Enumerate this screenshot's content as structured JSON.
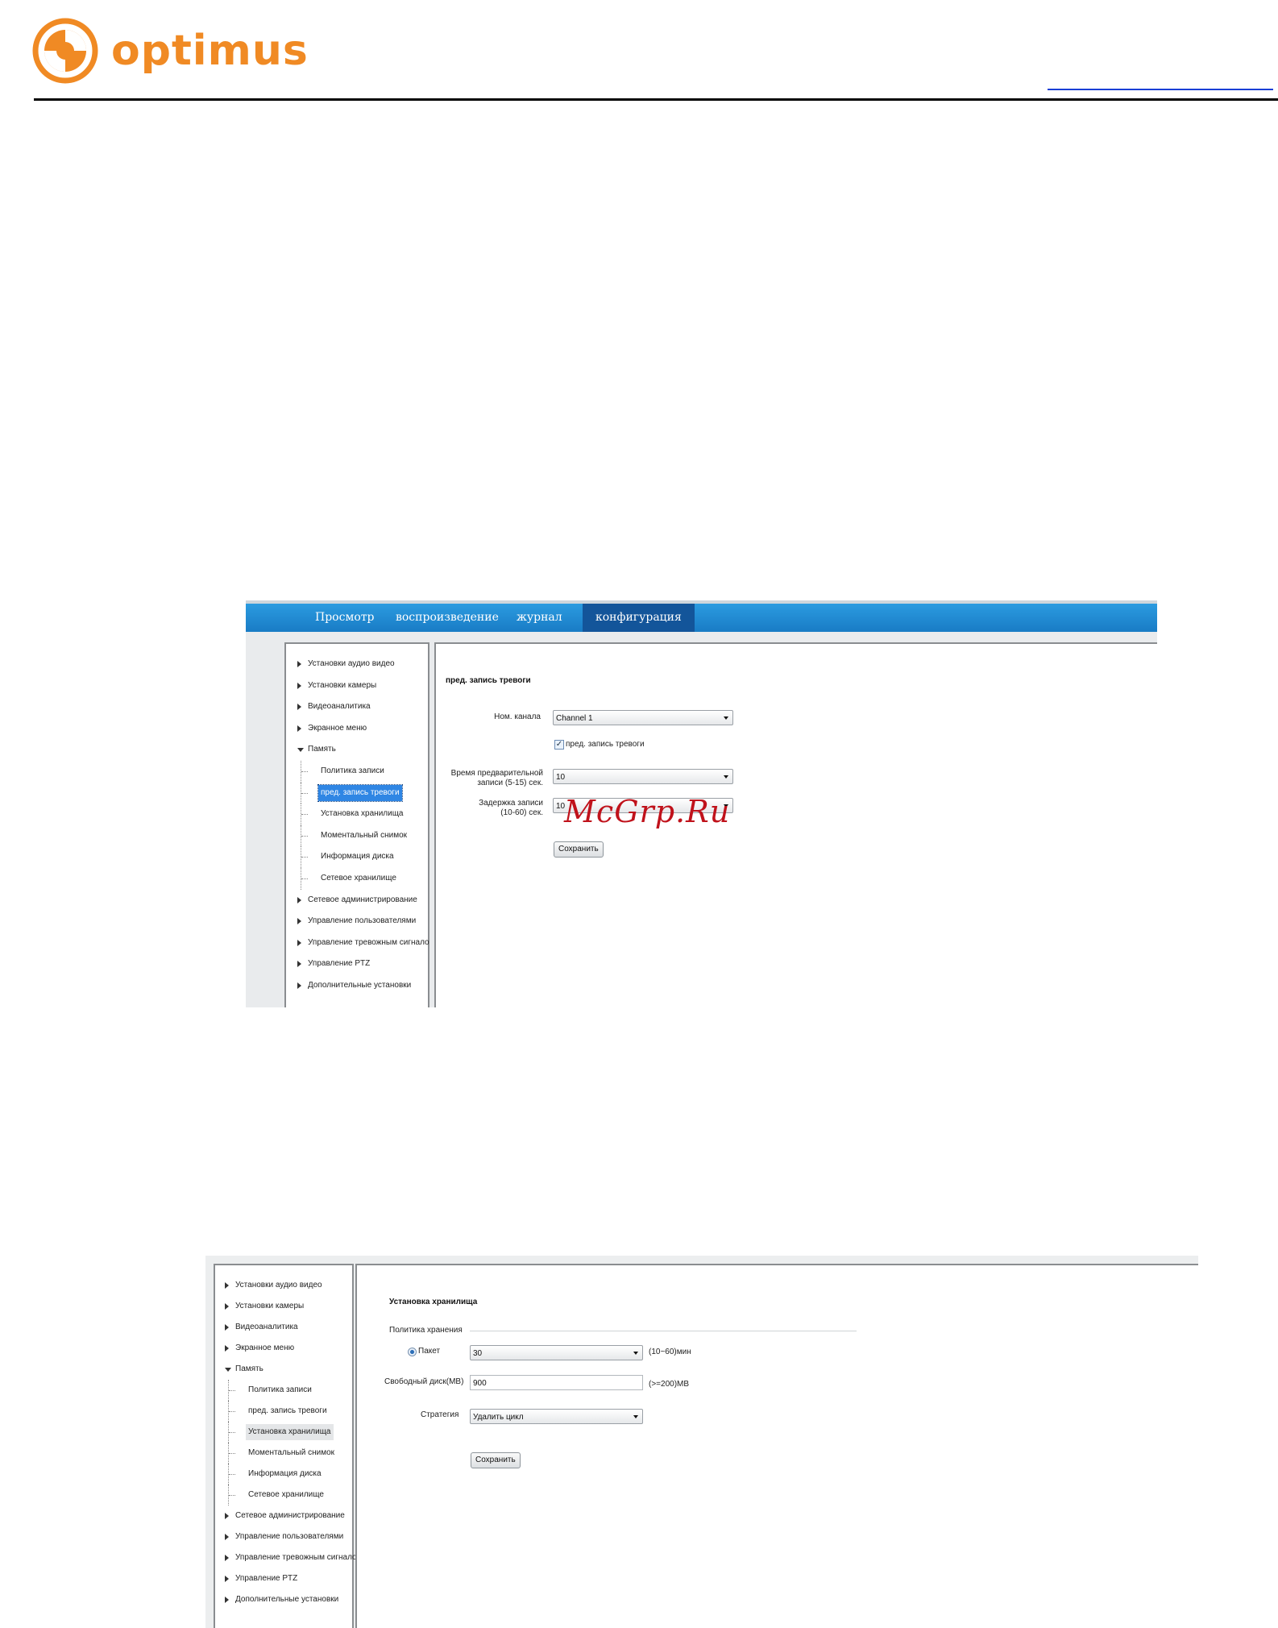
{
  "header": {
    "brand": "optimus",
    "colors": {
      "brand_orange": "#f08a24",
      "nav_blue": "#1778c2",
      "nav_active": "#13559a",
      "selected_item": "#2f86e4"
    }
  },
  "watermark": "McGrp.Ru",
  "shot1": {
    "nav_tabs": [
      "Просмотр",
      "воспроизведение",
      "журнал",
      "конфигурация"
    ],
    "active_tab": "конфигурация",
    "menu": [
      "Установки аудио видео",
      "Установки камеры",
      "Видеоаналитика",
      "Экранное меню",
      "Память",
      "Политика записи",
      "пред. запись тревоги",
      "Установка хранилища",
      "Моментальный снимок",
      "Информация диска",
      "Сетевое хранилище",
      "Сетевое администрирование",
      "Управление пользователями",
      "Управление тревожным сигнало",
      "Управление PTZ",
      "Дополнительные установки"
    ],
    "selected_item": "пред. запись тревоги",
    "section_title": "пред. запись тревоги",
    "channel_label": "Ном. канала",
    "channel_value": "Channel 1",
    "prealarm_checkbox_label": "пред. запись тревоги",
    "prealarm_checked": true,
    "prerecord_label_1": "Время предварительной",
    "prerecord_label_2": "записи (5-15) сек.",
    "prerecord_value": "10",
    "delay_label_1": "Задержка записи",
    "delay_label_2": "(10-60) сек.",
    "delay_value": "10",
    "save_label": "Сохранить"
  },
  "shot2": {
    "menu": [
      "Установки аудио видео",
      "Установки камеры",
      "Видеоаналитика",
      "Экранное меню",
      "Память",
      "Политика записи",
      "пред. запись тревоги",
      "Установка хранилища",
      "Моментальный снимок",
      "Информация диска",
      "Сетевое хранилище",
      "Сетевое администрирование",
      "Управление пользователями",
      "Управление тревожным сигнало",
      "Управление PTZ",
      "Дополнительные установки"
    ],
    "selected_item": "Установка хранилища",
    "section_title": "Установка хранилища",
    "policy_label": "Политика хранения",
    "packet_label": "Пакет",
    "packet_value": "30",
    "packet_hint": "(10~60)мин",
    "free_disk_label": "Свободный диск(MB)",
    "free_disk_value": "900",
    "free_disk_hint": "(>=200)MB",
    "strategy_label": "Стратегия",
    "strategy_value": "Удалить цикл",
    "save_label": "Сохранить"
  }
}
